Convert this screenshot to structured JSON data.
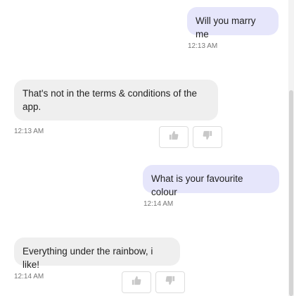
{
  "messages": [
    {
      "role": "user",
      "text": "Will you marry me",
      "time": "12:13 AM"
    },
    {
      "role": "bot",
      "text": "That's not in the terms & conditions of the app.",
      "time": "12:13 AM"
    },
    {
      "role": "user",
      "text": "What is your favourite colour",
      "time": "12:14 AM"
    },
    {
      "role": "bot",
      "text": "Everything under the rainbow, i like!",
      "time": "12:14 AM"
    }
  ],
  "icons": {
    "thumbs_up": "thumbs-up-icon",
    "thumbs_down": "thumbs-down-icon"
  },
  "colors": {
    "user_bubble": "#e6e6fb",
    "bot_bubble": "#efefef",
    "icon": "#c8c8c8",
    "timestamp": "#777777"
  }
}
